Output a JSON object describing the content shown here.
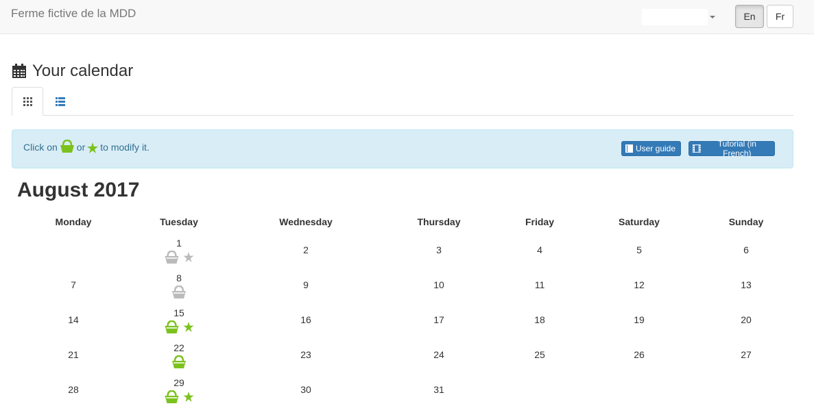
{
  "navbar": {
    "brand": "Ferme fictive de la MDD",
    "lang_en": "En",
    "lang_fr": "Fr"
  },
  "page": {
    "title": "Your calendar",
    "title_icon": "calendar-icon"
  },
  "tabs": [
    {
      "icon": "grid-icon",
      "active": true
    },
    {
      "icon": "list-icon",
      "active": false
    }
  ],
  "alert": {
    "prefix": "Click on",
    "middle": "or",
    "suffix": "to modify it.",
    "user_guide": "User guide",
    "tutorial": "Tutorial (in French)"
  },
  "calendar": {
    "month": "August 2017",
    "weekdays": [
      "Monday",
      "Tuesday",
      "Wednesday",
      "Thursday",
      "Friday",
      "Saturday",
      "Sunday"
    ],
    "days": [
      "1",
      "2",
      "3",
      "4",
      "5",
      "6",
      "7",
      "8",
      "9",
      "10",
      "11",
      "12",
      "13",
      "14",
      "15",
      "16",
      "17",
      "18",
      "19",
      "20",
      "21",
      "22",
      "23",
      "24",
      "25",
      "26",
      "27",
      "28",
      "29",
      "30",
      "31"
    ]
  },
  "colors": {
    "active_basket": "#7cc21e",
    "inactive_basket": "#bbbbbb",
    "primary": "#337ab7"
  }
}
